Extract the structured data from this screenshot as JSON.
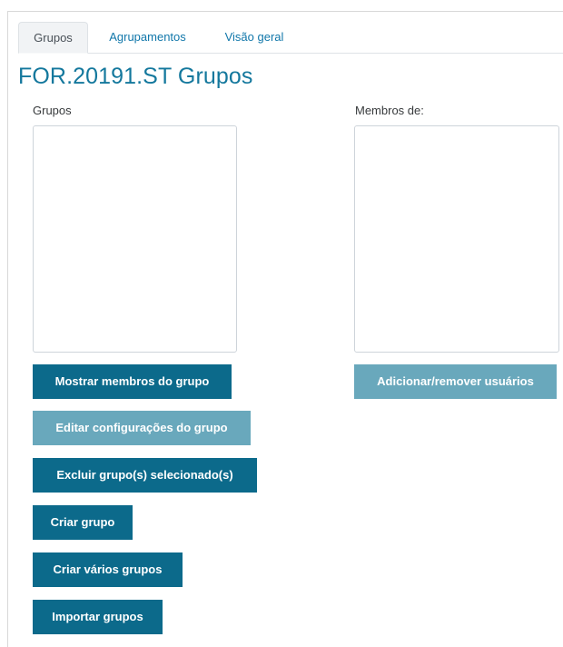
{
  "tabs": [
    {
      "label": "Grupos",
      "active": true
    },
    {
      "label": "Agrupamentos",
      "active": false
    },
    {
      "label": "Visão geral",
      "active": false
    }
  ],
  "page_title": "FOR.20191.ST Grupos",
  "groups_panel": {
    "label": "Grupos",
    "items": []
  },
  "members_panel": {
    "label": "Membros de:",
    "items": []
  },
  "buttons": {
    "show_members": "Mostrar membros do grupo",
    "add_remove_users": "Adicionar/remover usuários",
    "edit_group_settings": "Editar configurações do grupo",
    "delete_selected_groups": "Excluir grupo(s) selecionado(s)",
    "create_group": "Criar grupo",
    "create_multiple_groups": "Criar vários grupos",
    "import_groups": "Importar grupos"
  },
  "colors": {
    "primary": "#0c6a8b",
    "primary_disabled": "#69a8bc",
    "link": "#1177aa",
    "title": "#14789d"
  }
}
